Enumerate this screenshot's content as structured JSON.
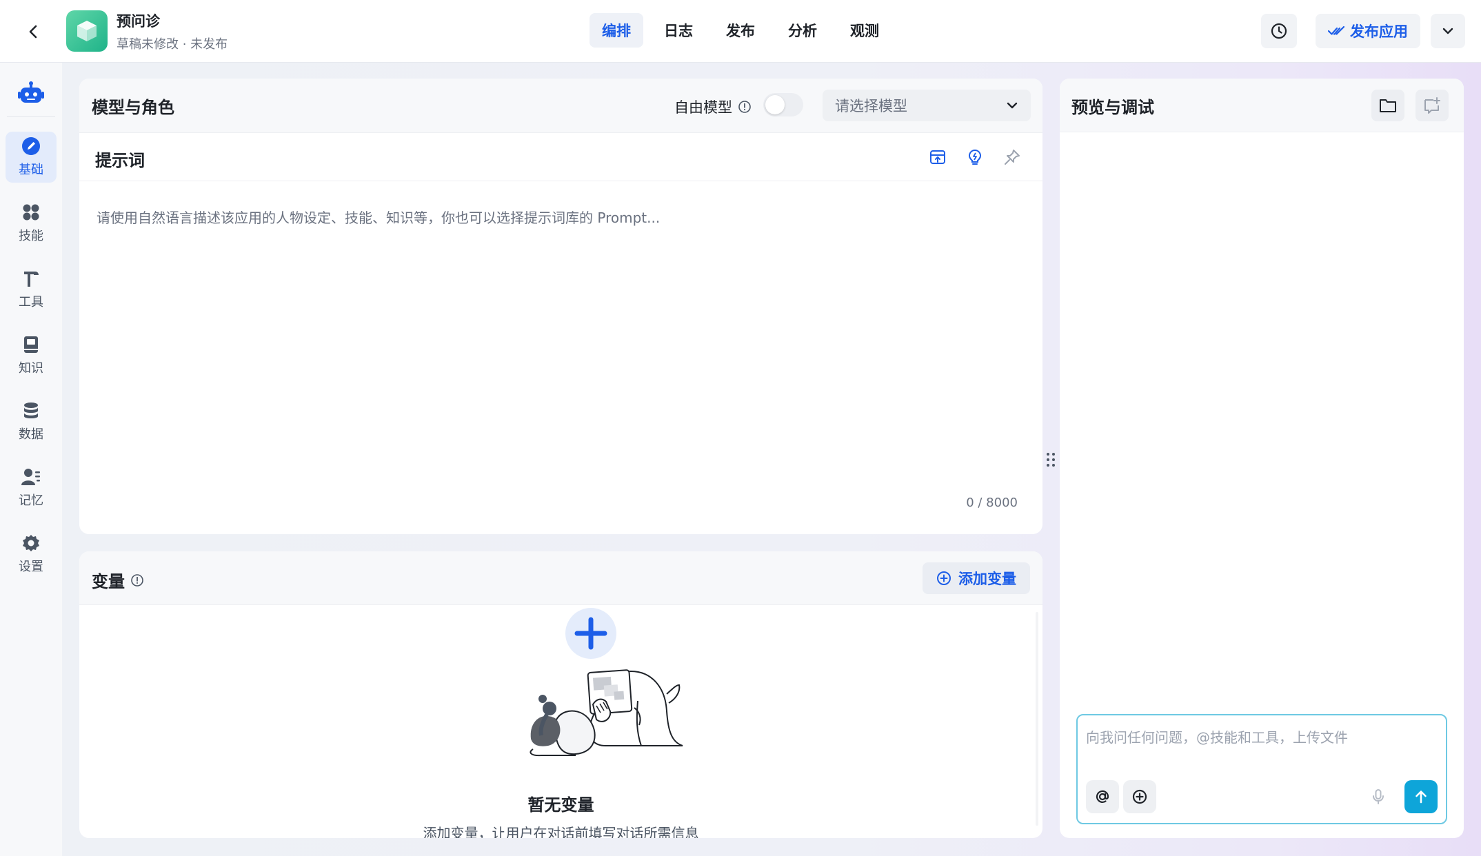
{
  "app": {
    "name": "预问诊",
    "status": "草稿未修改 · 未发布"
  },
  "nav": {
    "tabs": [
      "编排",
      "日志",
      "发布",
      "分析",
      "观测"
    ],
    "active_index": 0
  },
  "header_actions": {
    "publish_label": "发布应用"
  },
  "sidebar": {
    "items": [
      {
        "label": "基础",
        "icon": "pencil-icon",
        "active": true
      },
      {
        "label": "技能",
        "icon": "apps-icon",
        "active": false
      },
      {
        "label": "工具",
        "icon": "hammer-icon",
        "active": false
      },
      {
        "label": "知识",
        "icon": "book-icon",
        "active": false
      },
      {
        "label": "数据",
        "icon": "database-icon",
        "active": false
      },
      {
        "label": "记忆",
        "icon": "user-memory-icon",
        "active": false
      },
      {
        "label": "设置",
        "icon": "gear-icon",
        "active": false
      }
    ]
  },
  "model_panel": {
    "title": "模型与角色",
    "free_model_label": "自由模型",
    "free_model_enabled": false,
    "model_select_placeholder": "请选择模型"
  },
  "prompt": {
    "title": "提示词",
    "placeholder": "请使用自然语言描述该应用的人物设定、技能、知识等，你也可以选择提示词库的 Prompt...",
    "char_count": "0 / 8000"
  },
  "variables": {
    "title": "变量",
    "add_label": "添加变量",
    "empty_title": "暂无变量",
    "empty_desc": "添加变量，让用户在对话前填写对话所需信息"
  },
  "preview": {
    "title": "预览与调试",
    "input_placeholder": "向我问任何问题，@技能和工具，上传文件"
  },
  "colors": {
    "accent": "#1d5ee8",
    "active_bg": "#e3ebfb",
    "send_button": "#0ea5d9",
    "logo": "#1fb389"
  }
}
